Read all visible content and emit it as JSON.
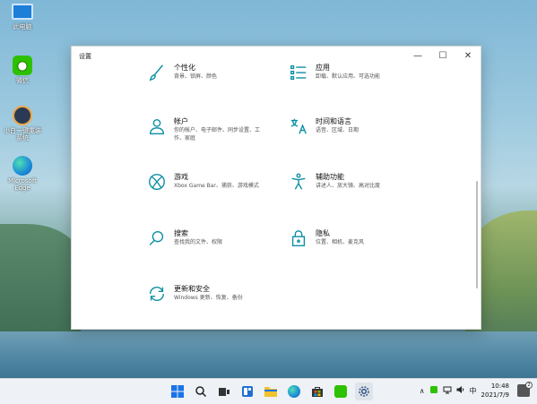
{
  "desktop": {
    "icons": [
      {
        "label": "此电脑",
        "icon": "computer-icon"
      },
      {
        "label": "微信",
        "icon": "wechat-icon"
      },
      {
        "label": "小白一键重装系统",
        "icon": "app-icon"
      },
      {
        "label": "Microsoft Edge",
        "icon": "edge-icon"
      }
    ]
  },
  "window": {
    "title": "设置",
    "controls": {
      "minimize": "—",
      "maximize": "☐",
      "close": "✕"
    },
    "tiles": [
      {
        "name": "个性化",
        "desc": "背景、锁屏、颜色",
        "icon": "brush-icon"
      },
      {
        "name": "应用",
        "desc": "卸载、默认应用、可选功能",
        "icon": "apps-list-icon"
      },
      {
        "name": "帐户",
        "desc": "你的帐户、电子邮件、同步设置、工作、家庭",
        "icon": "person-icon"
      },
      {
        "name": "时间和语言",
        "desc": "语音、区域、日期",
        "icon": "time-language-icon"
      },
      {
        "name": "游戏",
        "desc": "Xbox Game Bar、捕获、游戏模式",
        "icon": "xbox-icon"
      },
      {
        "name": "辅助功能",
        "desc": "讲述人、放大镜、高对比度",
        "icon": "accessibility-icon"
      },
      {
        "name": "搜索",
        "desc": "查找我的文件、权限",
        "icon": "search-icon"
      },
      {
        "name": "隐私",
        "desc": "位置、相机、麦克风",
        "icon": "lock-icon"
      },
      {
        "name": "更新和安全",
        "desc": "Windows 更新、恢复、备份",
        "icon": "sync-icon"
      }
    ]
  },
  "taskbar": {
    "tray": {
      "chevron": "∧",
      "ime": "中",
      "time": "10:48",
      "date": "2021/7/9",
      "notifications": "2"
    }
  },
  "colors": {
    "accent": "#0a8fa3",
    "taskbar": "#eef1f5"
  }
}
